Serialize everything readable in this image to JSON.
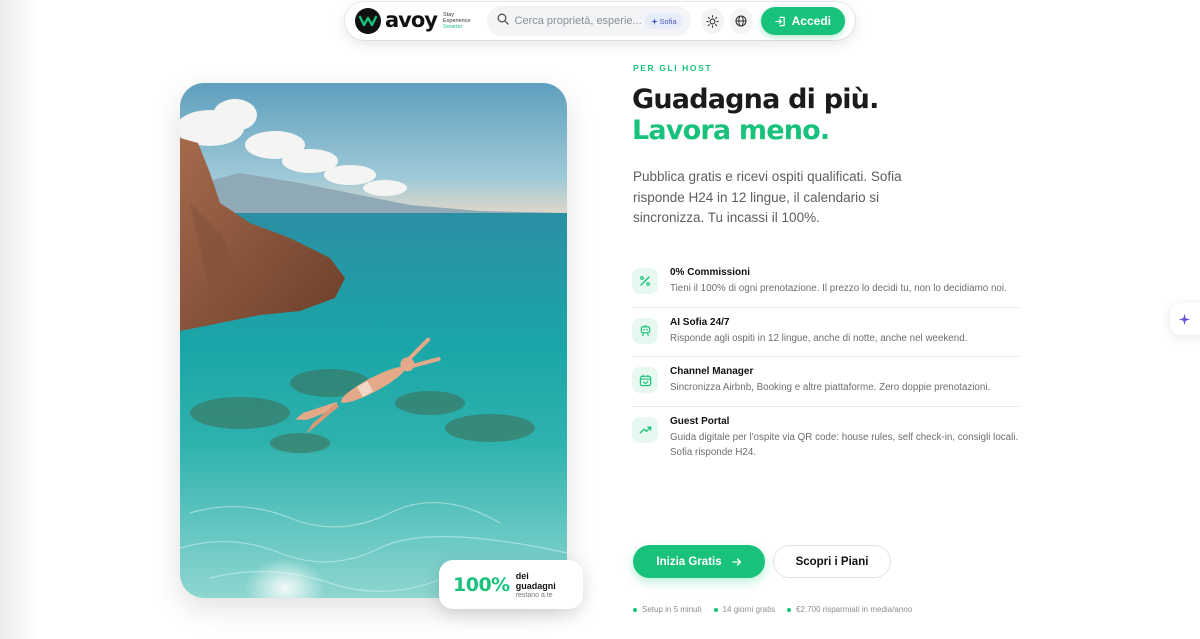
{
  "brand": {
    "name": "avoy",
    "tagline": [
      "Stay",
      "Experience",
      "Smarter"
    ]
  },
  "nav": {
    "search_placeholder": "Cerca proprietà, esperie...",
    "sofia_badge": "Sofia",
    "theme_icon": "sun-icon",
    "language_icon": "globe-icon",
    "login_label": "Accedi"
  },
  "hero": {
    "stat_value": "100%",
    "stat_label": "dei guadagni",
    "stat_sub": "restano a te"
  },
  "content": {
    "eyebrow": "PER GLI HOST",
    "headline_line1": "Guadagna di più.",
    "headline_line2": "Lavora meno.",
    "lead": "Pubblica gratis e ricevi ospiti qualificati. Sofia risponde H24 in 12 lingue, il calendario si sincronizza. Tu incassi il 100%.",
    "features": [
      {
        "icon": "percent-icon",
        "title": "0% Commissioni",
        "desc": "Tieni il 100% di ogni prenotazione. Il prezzo lo decidi tu, non lo decidiamo noi."
      },
      {
        "icon": "robot-icon",
        "title": "AI Sofia 24/7",
        "desc": "Risponde agli ospiti in 12 lingue, anche di notte, anche nel weekend."
      },
      {
        "icon": "calendar-sync-icon",
        "title": "Channel Manager",
        "desc": "Sincronizza Airbnb, Booking e altre piattaforme. Zero doppie prenotazioni."
      },
      {
        "icon": "trending-up-icon",
        "title": "Guest Portal",
        "desc": "Guida digitale per l'ospite via QR code: house rules, self check-in, consigli locali. Sofia risponde H24."
      }
    ],
    "cta_primary": "Inizia Gratis",
    "cta_secondary": "Scopri i Piani",
    "perks": [
      "Setup in 5 minuti",
      "14 giorni gratis",
      "€2.700 risparmiati in media/anno"
    ]
  },
  "colors": {
    "accent": "#19c27a",
    "text": "#1b1b1b",
    "muted": "#6b6f73"
  }
}
